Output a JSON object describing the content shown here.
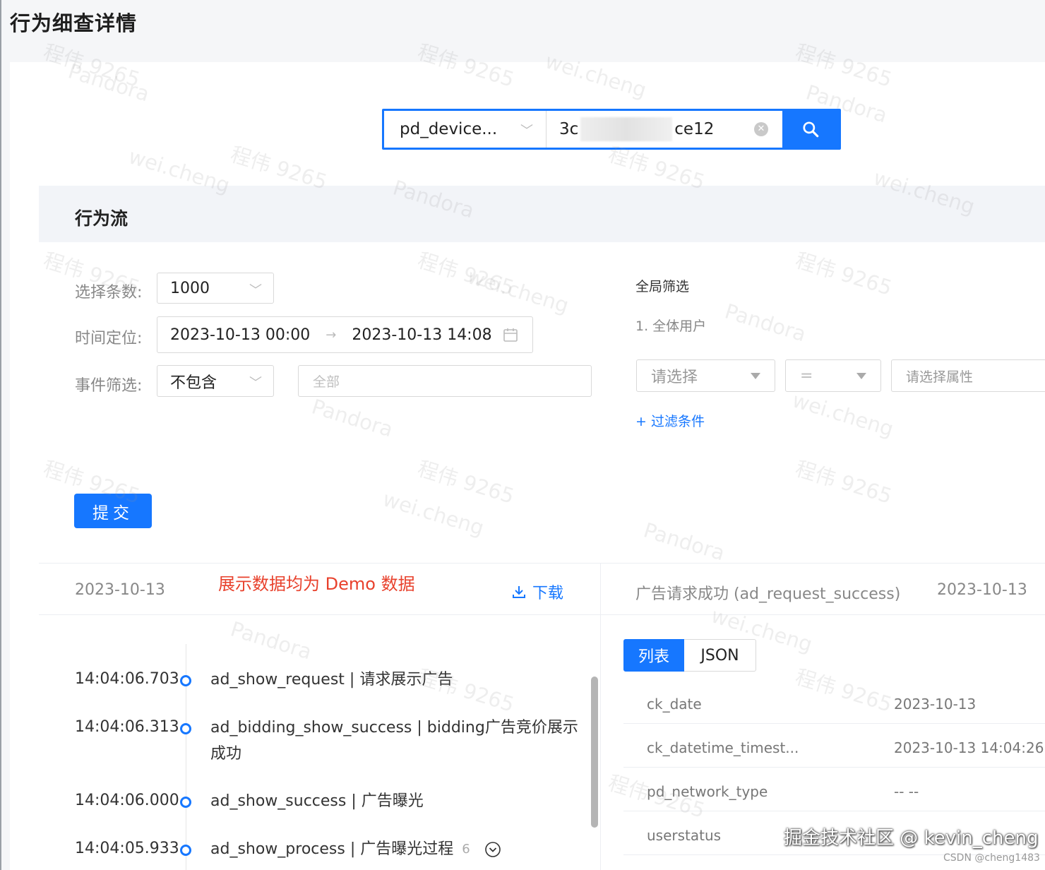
{
  "page": {
    "title": "行为细查详情"
  },
  "search": {
    "type_value": "pd_device...",
    "id_prefix": "3c",
    "id_suffix": "ce12"
  },
  "section": {
    "title": "行为流"
  },
  "form": {
    "count_label": "选择条数:",
    "count_value": "1000",
    "time_label": "时间定位:",
    "time_start": "2023-10-13 00:00",
    "time_arrow": "→",
    "time_end": "2023-10-13 14:08",
    "event_label": "事件筛选:",
    "event_mode": "不包含",
    "event_placeholder": "全部",
    "submit_label": "提交"
  },
  "global_filter": {
    "title": "全局筛选",
    "group": "1. 全体用户",
    "select_placeholder": "请选择",
    "operator": "=",
    "attr_placeholder": "请选择属性",
    "add_filter": "+ 过滤条件"
  },
  "flow": {
    "date": "2023-10-13",
    "demo_note": "展示数据均为 Demo 数据",
    "download_label": "下载",
    "events": [
      {
        "time": "14:04:06.703",
        "text": "ad_show_request | 请求展示广告"
      },
      {
        "time": "14:04:06.313",
        "text": "ad_bidding_show_success | bidding广告竞价展示成功"
      },
      {
        "time": "14:04:06.000",
        "text": "ad_show_success | 广告曝光"
      },
      {
        "time": "14:04:05.933",
        "text": "ad_show_process | 广告曝光过程",
        "count": "6"
      }
    ]
  },
  "detail": {
    "title": "广告请求成功 (ad_request_success)",
    "date": "2023-10-13",
    "tab_list": "列表",
    "tab_json": "JSON",
    "rows": [
      {
        "key": "ck_date",
        "value": "2023-10-13"
      },
      {
        "key": "ck_datetime_timest...",
        "value": "2023-10-13 14:04:26"
      },
      {
        "key": "pd_network_type",
        "value": "-- --"
      },
      {
        "key": "userstatus",
        "value": ""
      }
    ]
  },
  "watermarks": {
    "name": "程伟 9265",
    "user": "wei.cheng",
    "brand": "Pandora"
  },
  "footer": {
    "community": "掘金技术社区 @ kevin_cheng",
    "csdn": "CSDN @cheng1483"
  },
  "colors": {
    "primary": "#1677ff",
    "demo_note": "#e8412c"
  }
}
